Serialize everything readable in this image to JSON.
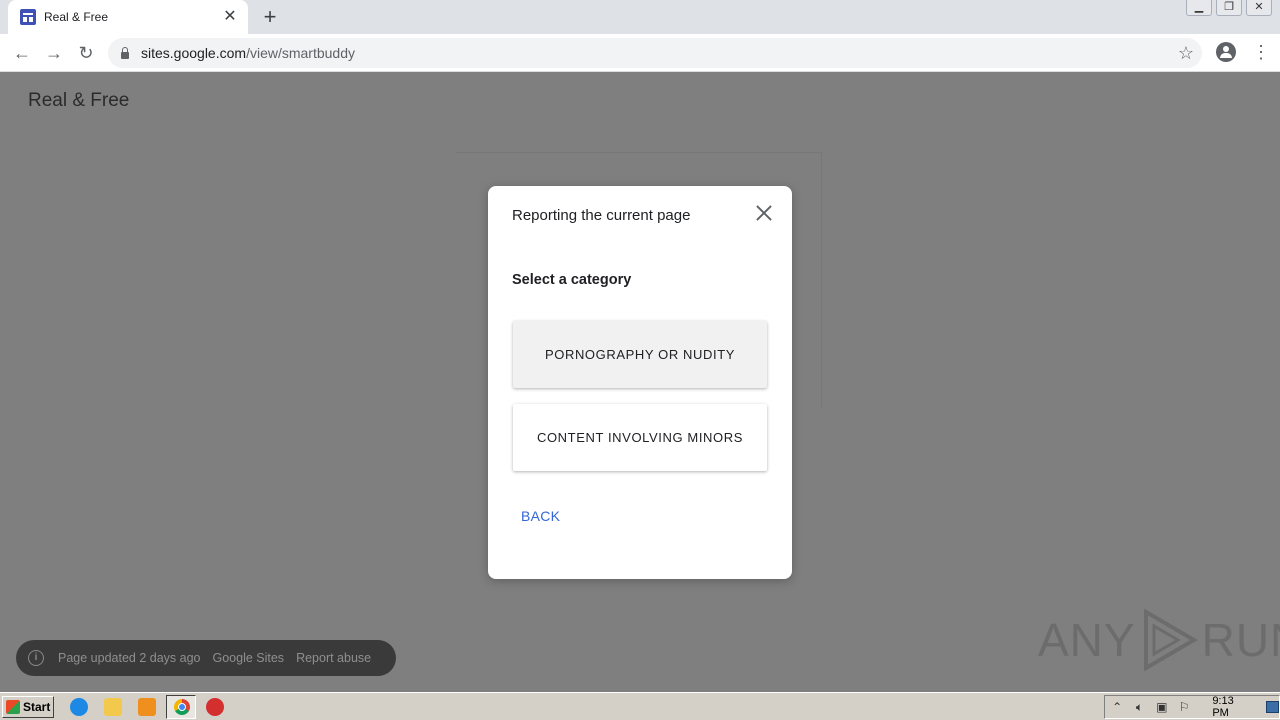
{
  "browser": {
    "tab_title": "Real & Free",
    "tab_close": "✕",
    "new_tab": "+",
    "url_domain": "sites.google.com",
    "url_path": "/view/smartbuddy"
  },
  "page": {
    "site_title": "Real & Free",
    "footer": {
      "updated": "Page updated 2 days ago",
      "google_sites": "Google Sites",
      "report_abuse": "Report abuse"
    },
    "watermark_left": "ANY",
    "watermark_right": "RUN"
  },
  "modal": {
    "title": "Reporting the current page",
    "subtitle": "Select a category",
    "options": [
      {
        "label": "PORNOGRAPHY OR NUDITY"
      },
      {
        "label": "CONTENT INVOLVING MINORS"
      }
    ],
    "back_label": "BACK"
  },
  "taskbar": {
    "start_label": "Start",
    "clock": "9:13 PM"
  },
  "colors": {
    "accent_link": "#3367d6",
    "overlay": "#7f7f7f"
  }
}
